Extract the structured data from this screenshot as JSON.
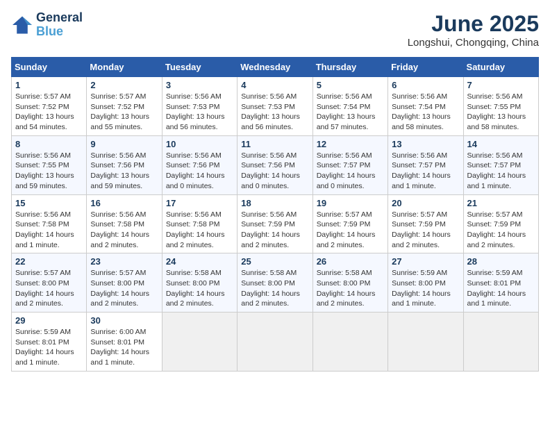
{
  "logo": {
    "line1": "General",
    "line2": "Blue"
  },
  "title": "June 2025",
  "location": "Longshui, Chongqing, China",
  "weekdays": [
    "Sunday",
    "Monday",
    "Tuesday",
    "Wednesday",
    "Thursday",
    "Friday",
    "Saturday"
  ],
  "weeks": [
    [
      {
        "day": "1",
        "sunrise": "5:57 AM",
        "sunset": "7:52 PM",
        "daylight": "13 hours and 54 minutes."
      },
      {
        "day": "2",
        "sunrise": "5:57 AM",
        "sunset": "7:52 PM",
        "daylight": "13 hours and 55 minutes."
      },
      {
        "day": "3",
        "sunrise": "5:56 AM",
        "sunset": "7:53 PM",
        "daylight": "13 hours and 56 minutes."
      },
      {
        "day": "4",
        "sunrise": "5:56 AM",
        "sunset": "7:53 PM",
        "daylight": "13 hours and 56 minutes."
      },
      {
        "day": "5",
        "sunrise": "5:56 AM",
        "sunset": "7:54 PM",
        "daylight": "13 hours and 57 minutes."
      },
      {
        "day": "6",
        "sunrise": "5:56 AM",
        "sunset": "7:54 PM",
        "daylight": "13 hours and 58 minutes."
      },
      {
        "day": "7",
        "sunrise": "5:56 AM",
        "sunset": "7:55 PM",
        "daylight": "13 hours and 58 minutes."
      }
    ],
    [
      {
        "day": "8",
        "sunrise": "5:56 AM",
        "sunset": "7:55 PM",
        "daylight": "13 hours and 59 minutes."
      },
      {
        "day": "9",
        "sunrise": "5:56 AM",
        "sunset": "7:56 PM",
        "daylight": "13 hours and 59 minutes."
      },
      {
        "day": "10",
        "sunrise": "5:56 AM",
        "sunset": "7:56 PM",
        "daylight": "14 hours and 0 minutes."
      },
      {
        "day": "11",
        "sunrise": "5:56 AM",
        "sunset": "7:56 PM",
        "daylight": "14 hours and 0 minutes."
      },
      {
        "day": "12",
        "sunrise": "5:56 AM",
        "sunset": "7:57 PM",
        "daylight": "14 hours and 0 minutes."
      },
      {
        "day": "13",
        "sunrise": "5:56 AM",
        "sunset": "7:57 PM",
        "daylight": "14 hours and 1 minute."
      },
      {
        "day": "14",
        "sunrise": "5:56 AM",
        "sunset": "7:57 PM",
        "daylight": "14 hours and 1 minute."
      }
    ],
    [
      {
        "day": "15",
        "sunrise": "5:56 AM",
        "sunset": "7:58 PM",
        "daylight": "14 hours and 1 minute."
      },
      {
        "day": "16",
        "sunrise": "5:56 AM",
        "sunset": "7:58 PM",
        "daylight": "14 hours and 2 minutes."
      },
      {
        "day": "17",
        "sunrise": "5:56 AM",
        "sunset": "7:58 PM",
        "daylight": "14 hours and 2 minutes."
      },
      {
        "day": "18",
        "sunrise": "5:56 AM",
        "sunset": "7:59 PM",
        "daylight": "14 hours and 2 minutes."
      },
      {
        "day": "19",
        "sunrise": "5:57 AM",
        "sunset": "7:59 PM",
        "daylight": "14 hours and 2 minutes."
      },
      {
        "day": "20",
        "sunrise": "5:57 AM",
        "sunset": "7:59 PM",
        "daylight": "14 hours and 2 minutes."
      },
      {
        "day": "21",
        "sunrise": "5:57 AM",
        "sunset": "7:59 PM",
        "daylight": "14 hours and 2 minutes."
      }
    ],
    [
      {
        "day": "22",
        "sunrise": "5:57 AM",
        "sunset": "8:00 PM",
        "daylight": "14 hours and 2 minutes."
      },
      {
        "day": "23",
        "sunrise": "5:57 AM",
        "sunset": "8:00 PM",
        "daylight": "14 hours and 2 minutes."
      },
      {
        "day": "24",
        "sunrise": "5:58 AM",
        "sunset": "8:00 PM",
        "daylight": "14 hours and 2 minutes."
      },
      {
        "day": "25",
        "sunrise": "5:58 AM",
        "sunset": "8:00 PM",
        "daylight": "14 hours and 2 minutes."
      },
      {
        "day": "26",
        "sunrise": "5:58 AM",
        "sunset": "8:00 PM",
        "daylight": "14 hours and 2 minutes."
      },
      {
        "day": "27",
        "sunrise": "5:59 AM",
        "sunset": "8:00 PM",
        "daylight": "14 hours and 1 minute."
      },
      {
        "day": "28",
        "sunrise": "5:59 AM",
        "sunset": "8:01 PM",
        "daylight": "14 hours and 1 minute."
      }
    ],
    [
      {
        "day": "29",
        "sunrise": "5:59 AM",
        "sunset": "8:01 PM",
        "daylight": "14 hours and 1 minute."
      },
      {
        "day": "30",
        "sunrise": "6:00 AM",
        "sunset": "8:01 PM",
        "daylight": "14 hours and 1 minute."
      },
      null,
      null,
      null,
      null,
      null
    ]
  ],
  "labels": {
    "sunrise_prefix": "Sunrise: ",
    "sunset_prefix": "Sunset: ",
    "daylight_prefix": "Daylight: "
  }
}
